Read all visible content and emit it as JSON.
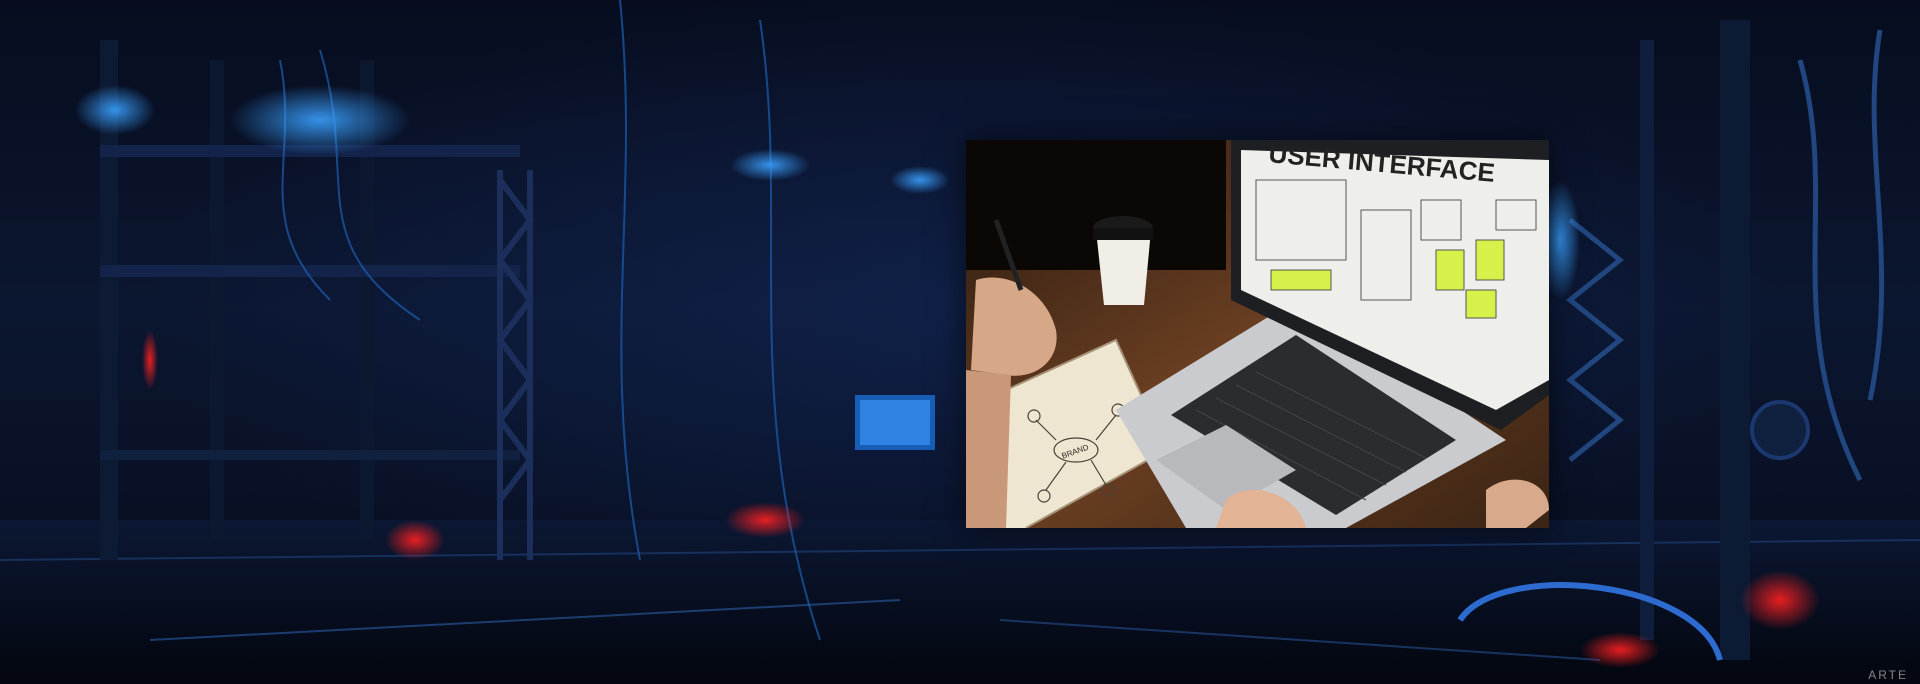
{
  "background": {
    "description_icon": "sci-fi-server-room-background",
    "colors": {
      "base": "#050a18",
      "accent_blue": "#1f7bff",
      "accent_red": "#ff2a2a"
    }
  },
  "photo": {
    "headline": "USER INTERFACE",
    "notebook_word": "BRAND"
  }
}
